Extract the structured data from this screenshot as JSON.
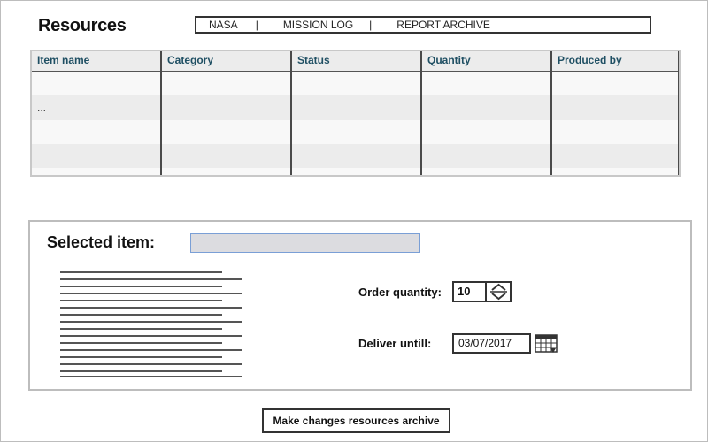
{
  "header": {
    "title": "Resources"
  },
  "topnav": {
    "items": [
      "NASA",
      "MISSION LOG",
      "REPORT ARCHIVE"
    ],
    "separator": "|"
  },
  "table": {
    "columns": [
      "Item name",
      "Category",
      "Status",
      "Quantity",
      "Produced by"
    ],
    "rows": [
      [
        "",
        "",
        "",
        "",
        ""
      ],
      [
        "...",
        "",
        "",
        "",
        ""
      ],
      [
        "",
        "",
        "",
        "",
        ""
      ],
      [
        "",
        "",
        "",
        "",
        ""
      ]
    ]
  },
  "selected_item": {
    "label": "Selected item:",
    "value": "",
    "order_quantity_label": "Order quantity:",
    "order_quantity_value": "10",
    "deliver_label": "Deliver untill:",
    "deliver_value": "03/07/2017"
  },
  "actions": {
    "submit_label": "Make changes resources archive"
  },
  "icons": {
    "stepper": "up-down-stepper-icon",
    "calendar": "calendar-icon"
  }
}
